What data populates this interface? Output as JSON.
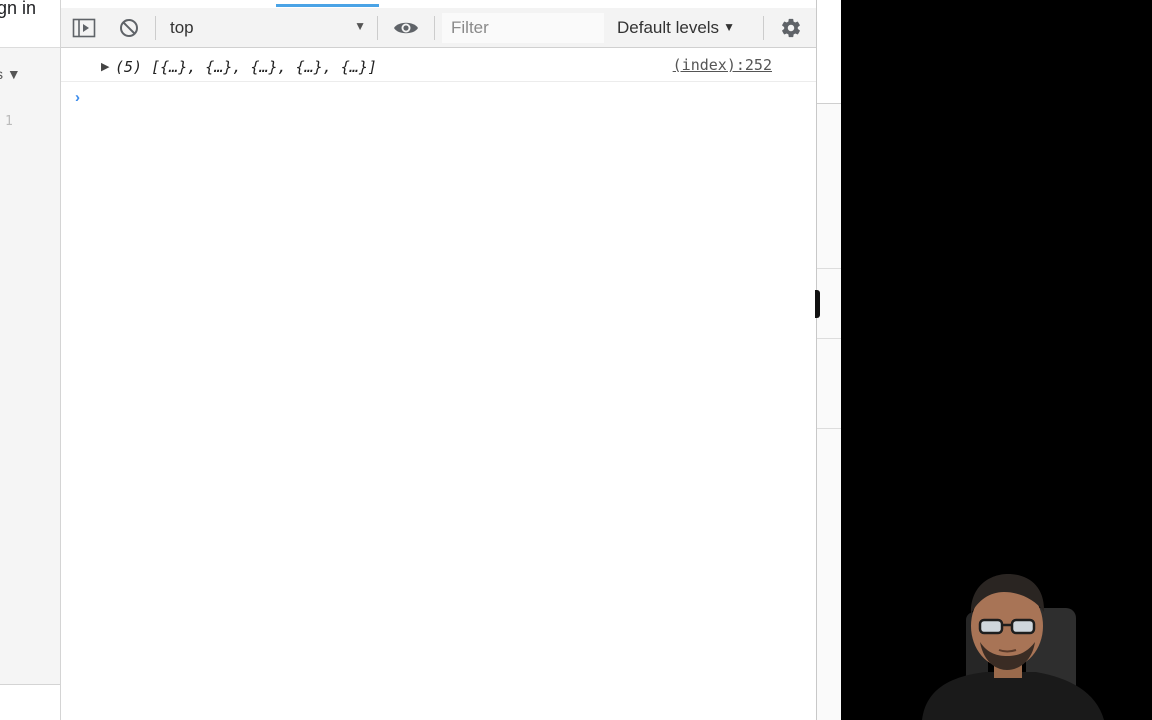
{
  "left_page": {
    "signin_text": "gn in",
    "filter_fragment": "s ▼",
    "line_number": "1"
  },
  "toolbar": {
    "context_value": "top",
    "filter_placeholder": "Filter",
    "levels_label": "Default levels"
  },
  "console": {
    "messages": [
      {
        "text": "(5) [{…}, {…}, {…}, {…}, {…}]",
        "source": "(index):252"
      }
    ],
    "prompt_symbol": "›"
  },
  "colors": {
    "accent": "#4aa3e6",
    "prompt": "#3b8beb"
  }
}
